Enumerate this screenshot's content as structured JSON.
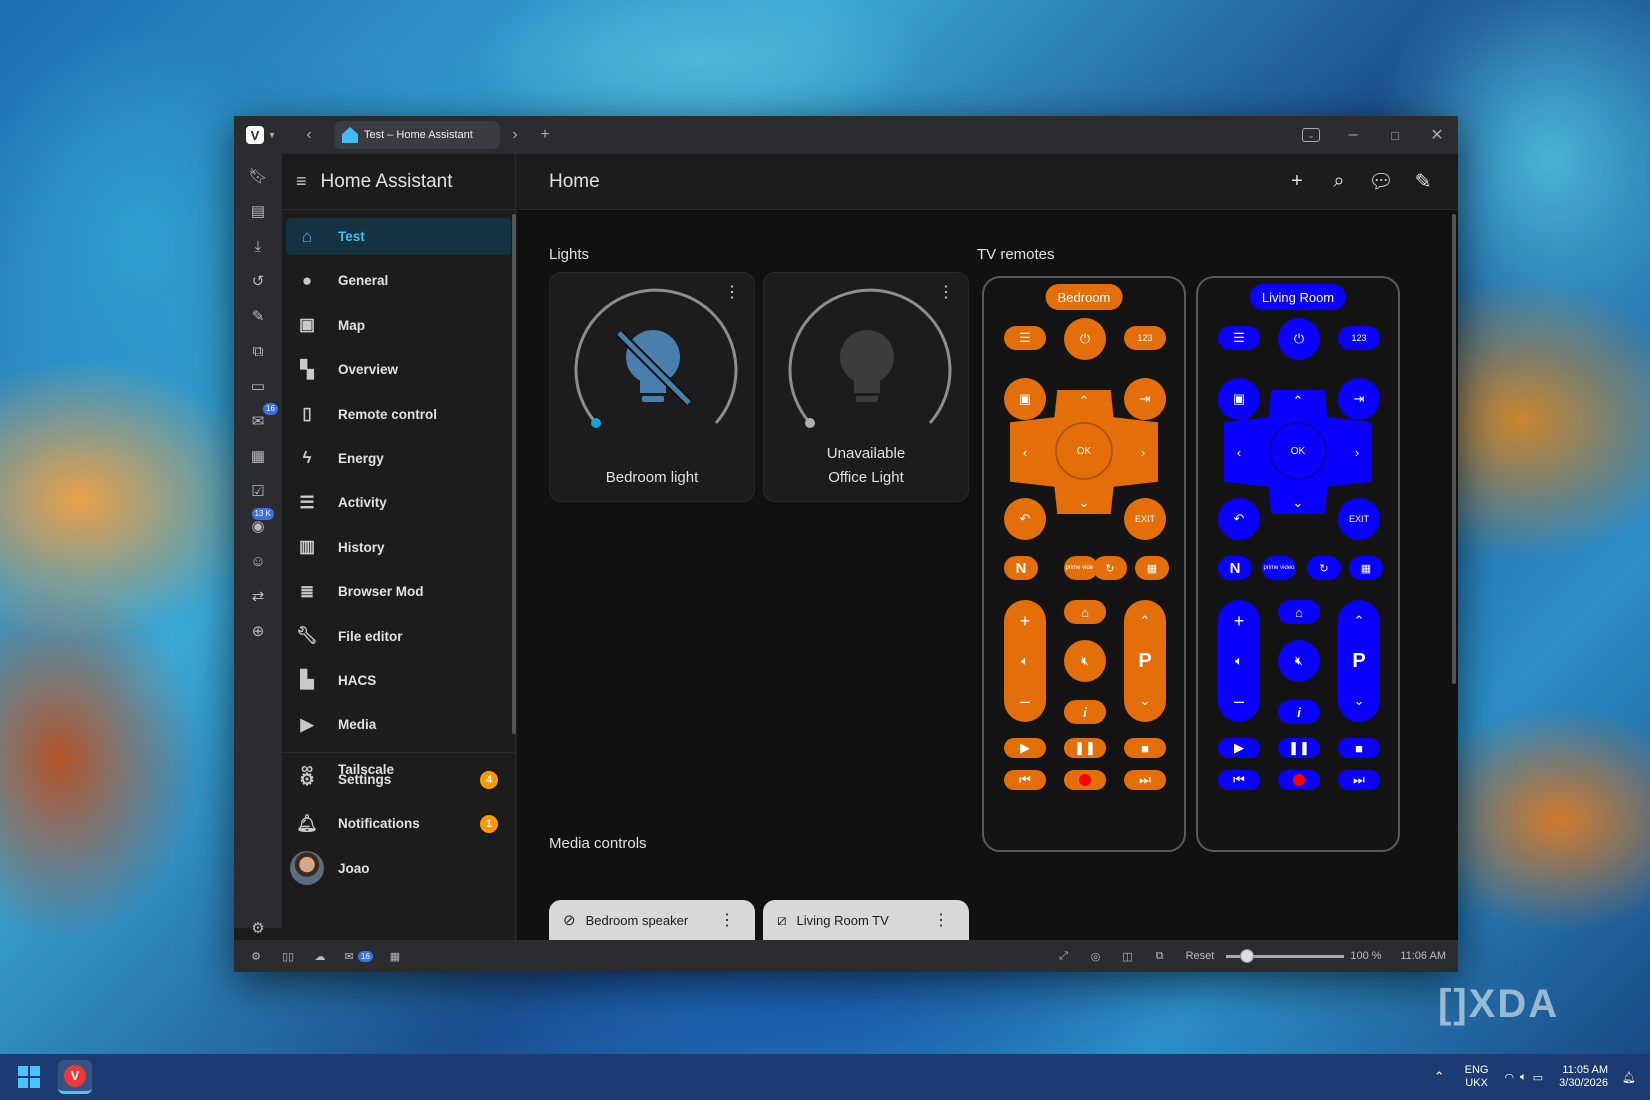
{
  "browser": {
    "tab_title": "Test – Home Assistant"
  },
  "sidebar": {
    "title": "Home Assistant",
    "items": [
      {
        "label": "Test",
        "icon": "home-icon"
      },
      {
        "label": "General",
        "icon": "person-icon"
      },
      {
        "label": "Map",
        "icon": "map-icon"
      },
      {
        "label": "Overview",
        "icon": "dashboard-icon"
      },
      {
        "label": "Remote control",
        "icon": "remote-icon"
      },
      {
        "label": "Energy",
        "icon": "lightning-icon"
      },
      {
        "label": "Activity",
        "icon": "list-icon"
      },
      {
        "label": "History",
        "icon": "chart-icon"
      },
      {
        "label": "Browser Mod",
        "icon": "server-icon"
      },
      {
        "label": "File editor",
        "icon": "wrench-icon"
      },
      {
        "label": "HACS",
        "icon": "hacs-icon"
      },
      {
        "label": "Media",
        "icon": "media-icon"
      },
      {
        "label": "Tailscale",
        "icon": "tailscale-icon"
      }
    ],
    "settings": {
      "label": "Settings",
      "badge": "4"
    },
    "notifications": {
      "label": "Notifications",
      "badge": "1"
    },
    "user": {
      "name": "Joao"
    }
  },
  "browser_panel": {
    "mail_badge": "16",
    "feed_badge": "13 K"
  },
  "main": {
    "title": "Home",
    "sections": {
      "lights": "Lights",
      "tv_remotes": "TV remotes",
      "media_controls": "Media controls"
    },
    "lights": [
      {
        "name": "Bedroom light",
        "state": ""
      },
      {
        "name": "Office Light",
        "state": "Unavailable"
      }
    ],
    "remotes": [
      {
        "name": "Bedroom",
        "color": "#e46f0a"
      },
      {
        "name": "Living Room",
        "color": "#0a00ff"
      }
    ],
    "remote_labels": {
      "num": "123",
      "ok": "OK",
      "exit": "EXIT",
      "p": "P",
      "n": "N",
      "prime": "prime video",
      "info": "i"
    },
    "media": [
      {
        "name": "Bedroom speaker"
      },
      {
        "name": "Living Room TV"
      }
    ]
  },
  "statusbar": {
    "reset": "Reset",
    "zoom": "100 %",
    "time": "11:06 AM",
    "mail_badge": "16"
  },
  "taskbar": {
    "lang": "ENG",
    "layout": "UKX",
    "time": "11:05 AM",
    "date": "3/30/2026"
  },
  "colors": {
    "ha_blue": "#41bdf5",
    "badge_orange": "#ff9800",
    "remote_orange": "#e46f0a",
    "remote_blue": "#0a00ff"
  }
}
